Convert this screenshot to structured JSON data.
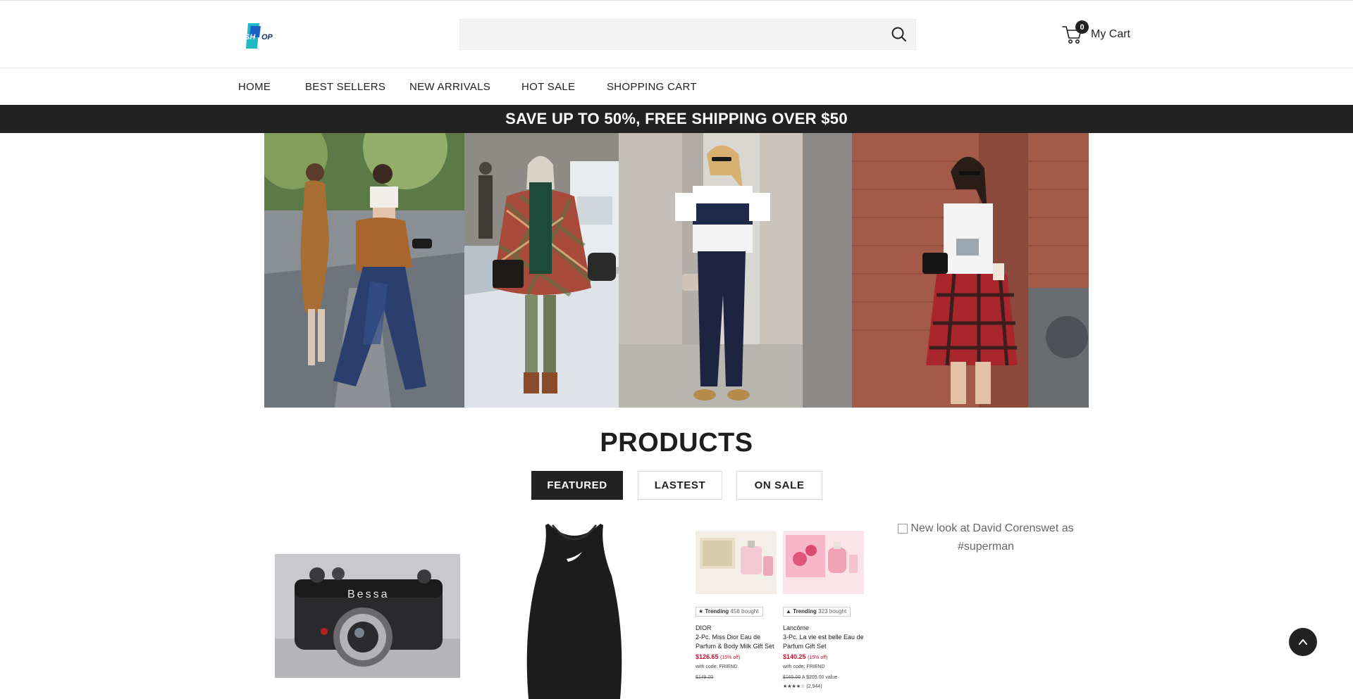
{
  "header": {
    "logo_text": "SHOP",
    "search": {
      "placeholder": "",
      "value": ""
    },
    "cart": {
      "count": "0",
      "label": "My Cart"
    }
  },
  "nav": {
    "items": [
      {
        "label": "HOME"
      },
      {
        "label": "BEST SELLERS"
      },
      {
        "label": "NEW ARRIVALS"
      },
      {
        "label": "HOT SALE"
      },
      {
        "label": "SHOPPING CART"
      }
    ]
  },
  "promo": {
    "text": "SAVE UP TO 50%, FREE SHIPPING OVER $50"
  },
  "products": {
    "title": "PRODUCTS",
    "tabs": [
      {
        "label": "FEATURED",
        "active": true
      },
      {
        "label": "LASTEST",
        "active": false
      },
      {
        "label": "ON SALE",
        "active": false
      }
    ],
    "items": [
      {
        "image_text": "Bessa"
      },
      {
        "image_text": ""
      },
      {
        "listings": [
          {
            "badge": "Trending",
            "bought": "458 bought",
            "brand": "DIOR",
            "name": "2-Pc. Miss Dior Eau de Parfum & Body Milk Gift Set",
            "price": "$126.65",
            "discount": "(15% off)",
            "code": "with code: FRIEND",
            "old_price": "$149.00"
          },
          {
            "badge": "Trending",
            "bought": "323 bought",
            "brand": "Lancôme",
            "name": "3-Pc. La vie est belle Eau de Parfum Gift Set",
            "price": "$140.25",
            "discount": "(15% off)",
            "code": "with code: FRIEND",
            "old_price": "$165.00",
            "value": "A $205.00 value",
            "rating_count": "(2,944)"
          }
        ]
      },
      {
        "alt_text": "New look at David Corenswet as #superman"
      }
    ]
  },
  "colors": {
    "dark": "#222222",
    "logo_blue": "#1a5ec8",
    "logo_teal": "#1fb8c4"
  }
}
